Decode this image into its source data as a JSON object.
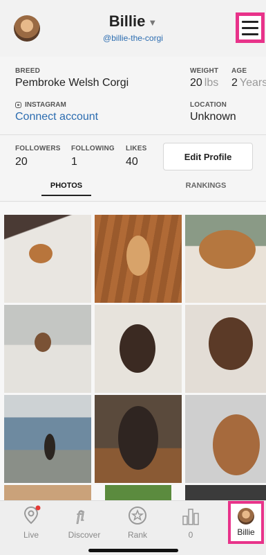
{
  "profile": {
    "name": "Billie",
    "handle": "@billie-the-corgi"
  },
  "info": {
    "breed_label": "BREED",
    "breed": "Pembroke Welsh Corgi",
    "weight_label": "WEIGHT",
    "weight_value": "20",
    "weight_unit": "lbs",
    "age_label": "AGE",
    "age_value": "2",
    "age_unit": "Years",
    "instagram_label": "INSTAGRAM",
    "instagram_link": "Connect account",
    "location_label": "LOCATION",
    "location": "Unknown"
  },
  "stats": {
    "followers_label": "FOLLOWERS",
    "followers": "20",
    "following_label": "FOLLOWING",
    "following": "1",
    "likes_label": "LIKES",
    "likes": "40",
    "edit_button": "Edit Profile"
  },
  "tabs": {
    "photos": "PHOTOS",
    "rankings": "RANKINGS"
  },
  "nav": {
    "live": "Live",
    "discover": "Discover",
    "rank": "Rank",
    "stats": "0",
    "billie": "Billie"
  },
  "colors": {
    "highlight": "#e8338a",
    "link": "#2b6cb0",
    "notification": "#e53935"
  }
}
